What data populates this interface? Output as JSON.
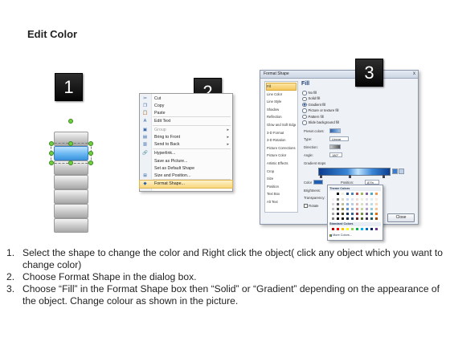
{
  "title": "Edit Color",
  "steps": [
    {
      "badge": "1"
    },
    {
      "badge": "2"
    },
    {
      "badge": "3"
    }
  ],
  "context_menu": {
    "items": [
      {
        "label": "Cut",
        "icon": "scissors-icon",
        "glyph": "✂",
        "disabled": false
      },
      {
        "label": "Copy",
        "icon": "copy-icon",
        "glyph": "❐",
        "disabled": false
      },
      {
        "label": "Paste",
        "icon": "paste-icon",
        "glyph": "📋",
        "disabled": false
      },
      {
        "label": "Edit Text",
        "icon": "edit-text-icon",
        "glyph": "A",
        "disabled": false
      },
      {
        "label": "Group",
        "icon": "group-icon",
        "glyph": "▣",
        "disabled": true
      },
      {
        "label": "Bring to Front",
        "icon": "bring-front-icon",
        "glyph": "▤",
        "disabled": false
      },
      {
        "label": "Send to Back",
        "icon": "send-back-icon",
        "glyph": "▥",
        "disabled": false
      },
      {
        "label": "Hyperlink...",
        "icon": "hyperlink-icon",
        "glyph": "🔗",
        "disabled": false
      },
      {
        "label": "Save as Picture...",
        "icon": "",
        "glyph": "",
        "disabled": false
      },
      {
        "label": "Set as Default Shape",
        "icon": "",
        "glyph": "",
        "disabled": false
      },
      {
        "label": "Size and Position...",
        "icon": "size-position-icon",
        "glyph": "⊞",
        "disabled": false
      },
      {
        "label": "Format Shape...",
        "icon": "format-shape-icon",
        "glyph": "◆",
        "disabled": false
      }
    ]
  },
  "format_dialog": {
    "title": "Format Shape",
    "close_x": "x",
    "categories": [
      "Fill",
      "Line Color",
      "Line Style",
      "Shadow",
      "Reflection",
      "Glow and Soft Edges",
      "3-D Format",
      "3-D Rotation",
      "Picture Corrections",
      "Picture Color",
      "Artistic Effects",
      "Crop",
      "Size",
      "Position",
      "Text Box",
      "Alt Text"
    ],
    "fill_header": "Fill",
    "fill_options": [
      {
        "label": "No fill",
        "selected": false
      },
      {
        "label": "Solid fill",
        "selected": false
      },
      {
        "label": "Gradient fill",
        "selected": true
      },
      {
        "label": "Picture or texture fill",
        "selected": false
      },
      {
        "label": "Pattern fill",
        "selected": false
      },
      {
        "label": "Slide background fill",
        "selected": false
      }
    ],
    "preset_colors_label": "Preset colors:",
    "type_label": "Type:",
    "type_value": "Linear",
    "direction_label": "Direction:",
    "angle_label": "Angle:",
    "angle_value": "180°",
    "gradient_stops_label": "Gradient stops",
    "color_label": "Color",
    "position_label": "Position:",
    "position_value": "87%",
    "brightness_label": "Brightness:",
    "transparency_label": "Transparency:",
    "rotate_label": "Rotate",
    "close_button": "Close"
  },
  "palette": {
    "theme_header": "Theme Colors",
    "standard_header": "Standard Colors",
    "more_colors": "More Colors...",
    "theme_top": [
      "#ffffff",
      "#000000",
      "#eeece1",
      "#1f497d",
      "#4f81bd",
      "#c0504d",
      "#9bbb59",
      "#8064a2",
      "#4bacc6",
      "#f79646"
    ],
    "theme_shades": [
      [
        "#f2f2f2",
        "#7f7f7f",
        "#ddd9c3",
        "#c6d9f0",
        "#dbe5f1",
        "#f2dcdb",
        "#ebf1dd",
        "#e5e0ec",
        "#dbeef3",
        "#fdeada"
      ],
      [
        "#d8d8d8",
        "#595959",
        "#c4bd97",
        "#8db3e2",
        "#b8cce4",
        "#e5b9b7",
        "#d7e3bc",
        "#ccc1d9",
        "#b7dde8",
        "#fbd5b5"
      ],
      [
        "#bfbfbf",
        "#3f3f3f",
        "#938953",
        "#548dd4",
        "#95b3d7",
        "#d99694",
        "#c3d69b",
        "#b2a2c7",
        "#92cddc",
        "#fac08f"
      ],
      [
        "#a5a5a5",
        "#262626",
        "#494429",
        "#17365d",
        "#366092",
        "#953734",
        "#76923c",
        "#5f497a",
        "#31859b",
        "#e36c09"
      ],
      [
        "#7f7f7f",
        "#0c0c0c",
        "#1d1b10",
        "#0f243e",
        "#244061",
        "#632423",
        "#4f6128",
        "#3f3151",
        "#205867",
        "#974806"
      ]
    ],
    "standard": [
      "#c00000",
      "#ff0000",
      "#ffc000",
      "#ffff00",
      "#92d050",
      "#00b050",
      "#00b0f0",
      "#0070c0",
      "#002060",
      "#7030a0"
    ]
  },
  "instructions": [
    {
      "num": "1.",
      "text": "Select the shape to change the color and Right click the object( click any object which you want to change color)"
    },
    {
      "num": "2.",
      "text": "Choose Format Shape in the dialog box."
    },
    {
      "num": "3.",
      "text": "Choose “Fill” in the Format Shape box then “Solid” or “Gradient” depending on the appearance of the object. Change colour as shown in the picture."
    }
  ]
}
